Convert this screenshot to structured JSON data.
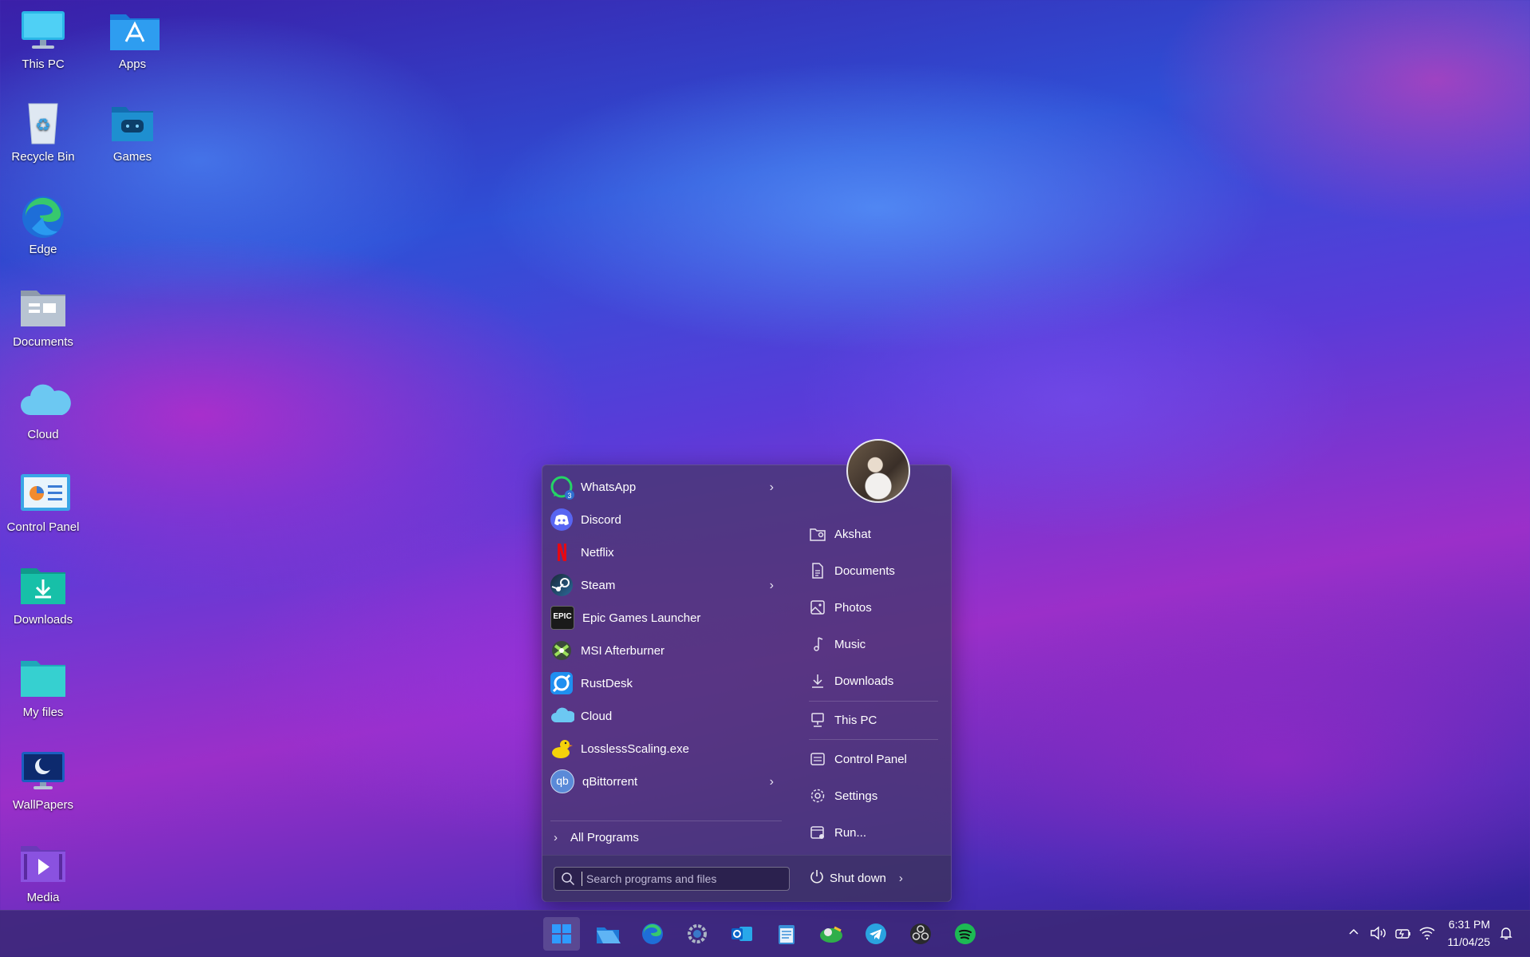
{
  "desktop": {
    "icons": [
      {
        "label": "This PC",
        "icon": "monitor-icon"
      },
      {
        "label": "Apps",
        "icon": "app-store-folder-icon"
      },
      {
        "label": "Recycle Bin",
        "icon": "recycle-bin-icon"
      },
      {
        "label": "Games",
        "icon": "games-folder-icon"
      },
      {
        "label": "Edge",
        "icon": "edge-icon"
      },
      {
        "label": "Documents",
        "icon": "documents-folder-icon"
      },
      {
        "label": "Cloud",
        "icon": "cloud-icon"
      },
      {
        "label": "Control Panel",
        "icon": "control-panel-icon"
      },
      {
        "label": "Downloads",
        "icon": "downloads-folder-icon"
      },
      {
        "label": "My files",
        "icon": "folder-icon"
      },
      {
        "label": "WallPapers",
        "icon": "wallpapers-icon"
      },
      {
        "label": "Media",
        "icon": "media-folder-icon"
      }
    ]
  },
  "start_menu": {
    "programs": [
      {
        "label": "WhatsApp",
        "icon": "whatsapp-icon",
        "badge": "3",
        "has_submenu": true
      },
      {
        "label": "Discord",
        "icon": "discord-icon"
      },
      {
        "label": "Netflix",
        "icon": "netflix-icon"
      },
      {
        "label": "Steam",
        "icon": "steam-icon",
        "has_submenu": true
      },
      {
        "label": "Epic Games Launcher",
        "icon": "epic-games-icon",
        "icon_text": "EPIC"
      },
      {
        "label": "MSI Afterburner",
        "icon": "msi-afterburner-icon"
      },
      {
        "label": "RustDesk",
        "icon": "rustdesk-icon"
      },
      {
        "label": "Cloud",
        "icon": "cloud-icon"
      },
      {
        "label": "LosslessScaling.exe",
        "icon": "duck-icon"
      },
      {
        "label": "qBittorrent",
        "icon": "qbittorrent-icon",
        "icon_text": "qb",
        "has_submenu": true
      }
    ],
    "all_programs_label": "All Programs",
    "places": [
      {
        "label": "Akshat",
        "icon": "user-folder-icon"
      },
      {
        "label": "Documents",
        "icon": "document-icon"
      },
      {
        "label": "Photos",
        "icon": "photo-icon"
      },
      {
        "label": "Music",
        "icon": "music-note-icon"
      },
      {
        "label": "Downloads",
        "icon": "download-icon"
      },
      {
        "label": "This PC",
        "icon": "computer-icon"
      },
      {
        "label": "Control Panel",
        "icon": "control-panel-icon"
      },
      {
        "label": "Settings",
        "icon": "gear-icon"
      },
      {
        "label": "Run...",
        "icon": "run-icon"
      }
    ],
    "search_placeholder": "Search programs and files",
    "shutdown_label": "Shut down"
  },
  "taskbar": {
    "apps": [
      "windows-start-icon",
      "file-explorer-icon",
      "edge-icon",
      "settings-icon",
      "outlook-icon",
      "notepad-icon",
      "pinball-icon",
      "telegram-icon",
      "obs-icon",
      "spotify-icon"
    ],
    "time": "6:31 PM",
    "date": "11/04/25"
  },
  "colors": {
    "accent": "#2f9bff",
    "whatsapp": "#25d366",
    "discord": "#5865f2",
    "netflix": "#e50914",
    "spotify": "#1db954"
  }
}
